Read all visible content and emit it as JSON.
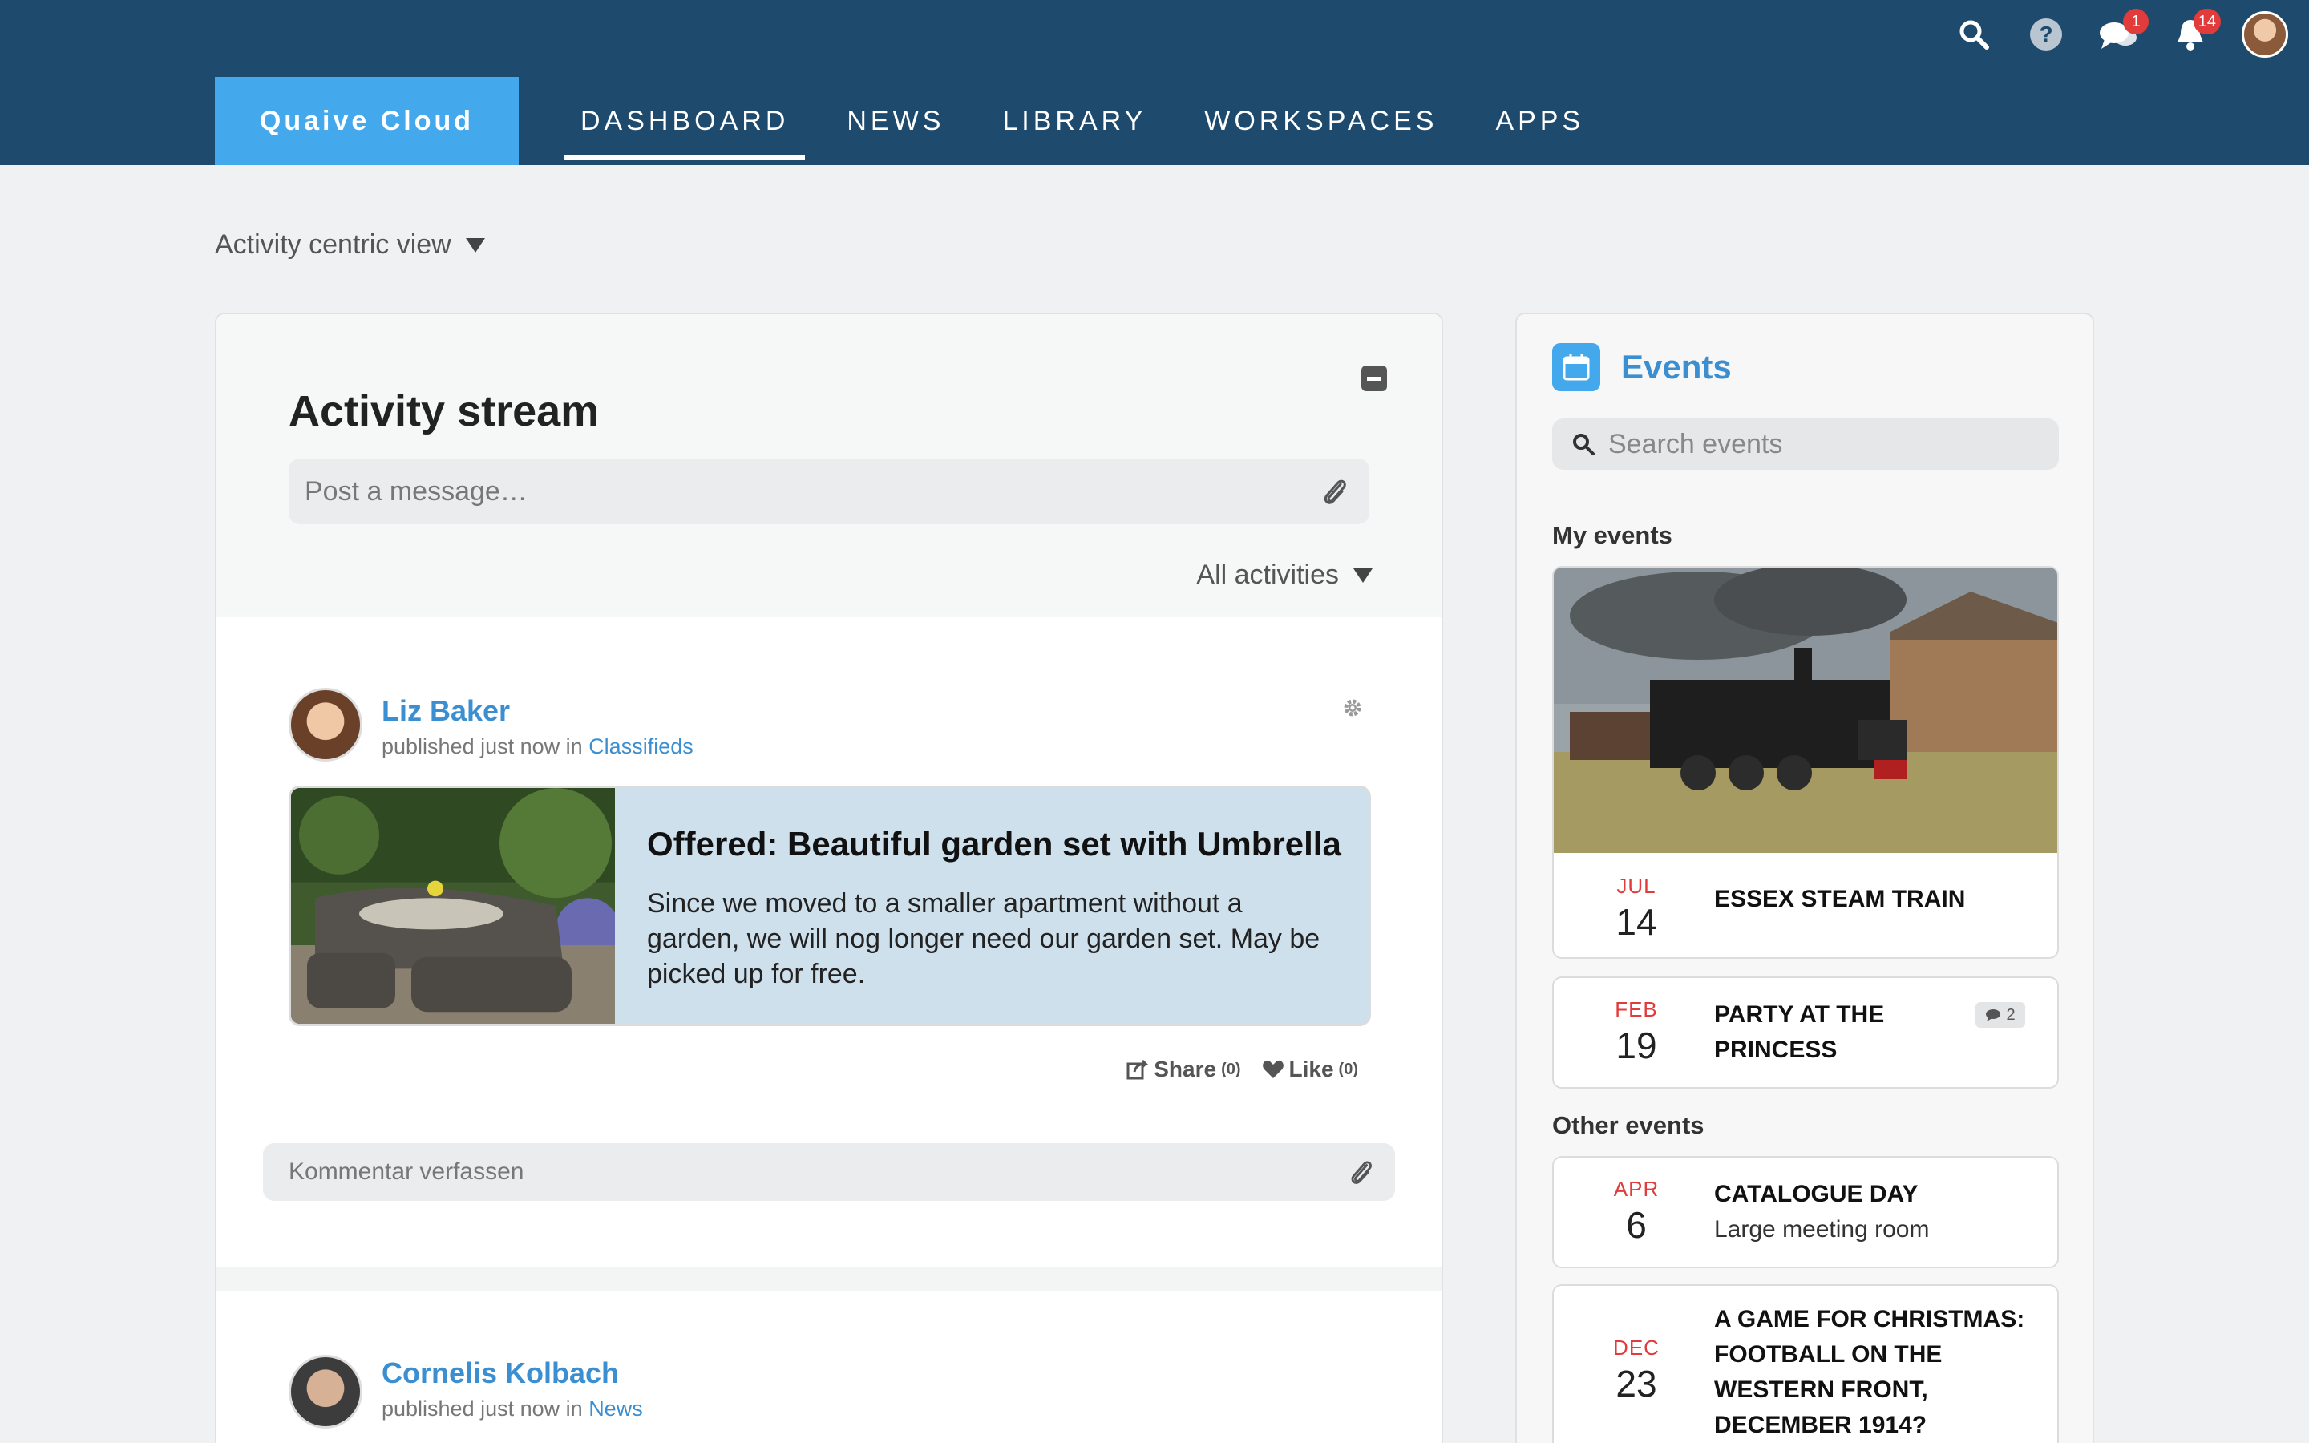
{
  "brand": "Quaive Cloud",
  "nav": {
    "items": [
      {
        "label": "DASHBOARD",
        "active": true
      },
      {
        "label": "NEWS"
      },
      {
        "label": "LIBRARY"
      },
      {
        "label": "WORKSPACES"
      },
      {
        "label": "APPS"
      }
    ]
  },
  "top_icons": {
    "search": "search-icon",
    "help": "help-icon",
    "messages_badge": "1",
    "notifications_badge": "14"
  },
  "view_selector": "Activity centric view",
  "activity": {
    "title": "Activity stream",
    "post_placeholder": "Post a message…",
    "filter": "All activities",
    "posts": [
      {
        "author": "Liz Baker",
        "meta_prefix": "published just now in",
        "meta_link": "Classifieds",
        "item_title": "Offered: Beautiful garden set with Umbrella",
        "item_desc": "Since we moved to a smaller apartment without a garden, we will nog longer need our garden set. May be picked up for free.",
        "share_label": "Share",
        "share_count": "(0)",
        "like_label": "Like",
        "like_count": "(0)",
        "comment_placeholder": "Kommentar verfassen"
      },
      {
        "author": "Cornelis Kolbach",
        "meta_prefix": "published just now in",
        "meta_link": "News"
      }
    ]
  },
  "events": {
    "title": "Events",
    "search_placeholder": "Search events",
    "my_events_label": "My events",
    "other_events_label": "Other events",
    "my_events": [
      {
        "month": "JUL",
        "day": "14",
        "title": "ESSEX STEAM TRAIN"
      },
      {
        "month": "FEB",
        "day": "19",
        "title": "PARTY AT THE PRINCESS",
        "comments": "2"
      }
    ],
    "other_events": [
      {
        "month": "APR",
        "day": "6",
        "title": "CATALOGUE DAY",
        "subtitle": "Large meeting room"
      },
      {
        "month": "DEC",
        "day": "23",
        "title": "A GAME FOR CHRISTMAS: FOOTBALL ON THE WESTERN FRONT, DECEMBER 1914?"
      }
    ]
  },
  "colors": {
    "topbar": "#1d4a6d",
    "brand": "#44a8ec",
    "link": "#3b8fd0",
    "badge": "#e23b3b"
  }
}
